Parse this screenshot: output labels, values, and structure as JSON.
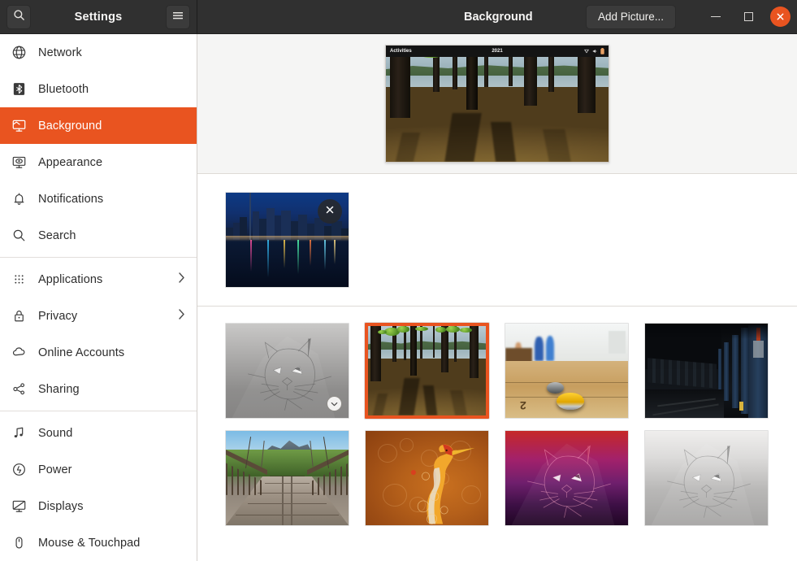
{
  "window": {
    "app_title": "Settings",
    "panel_title": "Background",
    "add_picture_label": "Add Picture...",
    "accent_color": "#e95420",
    "titlebar_color": "#303030",
    "controls": {
      "search_icon": "search-icon",
      "menu_icon": "hamburger-menu-icon",
      "minimize_icon": "minimize-icon",
      "maximize_icon": "maximize-icon",
      "close_icon": "close-icon"
    }
  },
  "sidebar": {
    "groups": [
      {
        "items": [
          {
            "label": "Network",
            "icon": "network-globe-icon",
            "active": false,
            "has_chevron": false
          },
          {
            "label": "Bluetooth",
            "icon": "bluetooth-icon",
            "active": false,
            "has_chevron": false
          },
          {
            "label": "Background",
            "icon": "background-monitor-icon",
            "active": true,
            "has_chevron": false
          },
          {
            "label": "Appearance",
            "icon": "appearance-icon",
            "active": false,
            "has_chevron": false
          },
          {
            "label": "Notifications",
            "icon": "bell-icon",
            "active": false,
            "has_chevron": false
          },
          {
            "label": "Search",
            "icon": "search-icon",
            "active": false,
            "has_chevron": false
          }
        ]
      },
      {
        "items": [
          {
            "label": "Applications",
            "icon": "grid-dots-icon",
            "active": false,
            "has_chevron": true
          },
          {
            "label": "Privacy",
            "icon": "lock-icon",
            "active": false,
            "has_chevron": true
          },
          {
            "label": "Online Accounts",
            "icon": "cloud-icon",
            "active": false,
            "has_chevron": false
          },
          {
            "label": "Sharing",
            "icon": "share-nodes-icon",
            "active": false,
            "has_chevron": false
          }
        ]
      },
      {
        "items": [
          {
            "label": "Sound",
            "icon": "music-note-icon",
            "active": false,
            "has_chevron": false
          },
          {
            "label": "Power",
            "icon": "power-icon",
            "active": false,
            "has_chevron": false
          },
          {
            "label": "Displays",
            "icon": "displays-icon",
            "active": false,
            "has_chevron": false
          },
          {
            "label": "Mouse & Touchpad",
            "icon": "mouse-icon",
            "active": false,
            "has_chevron": false
          }
        ]
      }
    ]
  },
  "preview": {
    "activities_label": "Activities",
    "clock_label": "2021",
    "status_icons": [
      "network-icon",
      "volume-icon",
      "battery-icon"
    ],
    "wallpaper": "forest-sunlit-trees-lake"
  },
  "custom_pictures": [
    {
      "name": "toronto-skyline-night",
      "selected": false,
      "delete_label": "×",
      "delete_icon": "close-icon"
    }
  ],
  "wallpaper_grid": [
    {
      "name": "ubuntu-lynx-grey-dark",
      "selected": false,
      "badge": "check-circle-icon"
    },
    {
      "name": "forest-sunlit-trees-lake",
      "selected": true,
      "badge": null
    },
    {
      "name": "shuffleboard-table",
      "selected": false,
      "badge": null
    },
    {
      "name": "subway-platform-dark",
      "selected": false,
      "badge": null
    },
    {
      "name": "suspension-bridge-mountains",
      "selected": false,
      "badge": null
    },
    {
      "name": "ubuntu-heron-orange",
      "selected": false,
      "badge": null
    },
    {
      "name": "ubuntu-lynx-purple-red",
      "selected": false,
      "badge": null
    },
    {
      "name": "ubuntu-lynx-grey-light",
      "selected": false,
      "badge": null
    }
  ]
}
